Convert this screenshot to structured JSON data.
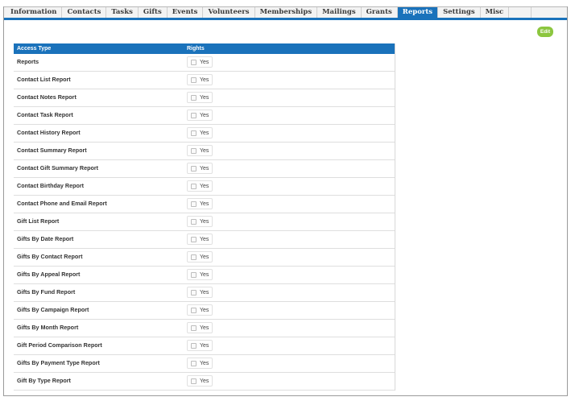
{
  "tabs": [
    {
      "label": "Information",
      "active": false
    },
    {
      "label": "Contacts",
      "active": false
    },
    {
      "label": "Tasks",
      "active": false
    },
    {
      "label": "Gifts",
      "active": false
    },
    {
      "label": "Events",
      "active": false
    },
    {
      "label": "Volunteers",
      "active": false
    },
    {
      "label": "Memberships",
      "active": false
    },
    {
      "label": "Mailings",
      "active": false
    },
    {
      "label": "Grants",
      "active": false
    },
    {
      "label": "Reports",
      "active": true
    },
    {
      "label": "Settings",
      "active": false
    },
    {
      "label": "Misc",
      "active": false
    }
  ],
  "edit_label": "Edit",
  "table": {
    "headers": {
      "access_type": "Access Type",
      "rights": "Rights"
    },
    "rows": [
      {
        "label": "Reports",
        "checkbox_label": "Yes",
        "checked": false
      },
      {
        "label": "Contact List Report",
        "checkbox_label": "Yes",
        "checked": false
      },
      {
        "label": "Contact Notes Report",
        "checkbox_label": "Yes",
        "checked": false
      },
      {
        "label": "Contact Task Report",
        "checkbox_label": "Yes",
        "checked": false
      },
      {
        "label": "Contact History Report",
        "checkbox_label": "Yes",
        "checked": false
      },
      {
        "label": "Contact Summary Report",
        "checkbox_label": "Yes",
        "checked": false
      },
      {
        "label": "Contact Gift Summary Report",
        "checkbox_label": "Yes",
        "checked": false
      },
      {
        "label": "Contact Birthday Report",
        "checkbox_label": "Yes",
        "checked": false
      },
      {
        "label": "Contact Phone and Email Report",
        "checkbox_label": "Yes",
        "checked": false
      },
      {
        "label": "Gift List Report",
        "checkbox_label": "Yes",
        "checked": false
      },
      {
        "label": "Gifts By Date Report",
        "checkbox_label": "Yes",
        "checked": false
      },
      {
        "label": "Gifts By Contact Report",
        "checkbox_label": "Yes",
        "checked": false
      },
      {
        "label": "Gifts By Appeal Report",
        "checkbox_label": "Yes",
        "checked": false
      },
      {
        "label": "Gifts By Fund Report",
        "checkbox_label": "Yes",
        "checked": false
      },
      {
        "label": "Gifts By Campaign Report",
        "checkbox_label": "Yes",
        "checked": false
      },
      {
        "label": "Gifts By Month Report",
        "checkbox_label": "Yes",
        "checked": false
      },
      {
        "label": "Gift Period Comparison Report",
        "checkbox_label": "Yes",
        "checked": false
      },
      {
        "label": "Gifts By Payment Type Report",
        "checkbox_label": "Yes",
        "checked": false
      },
      {
        "label": "Gift By Type Report",
        "checkbox_label": "Yes",
        "checked": false
      }
    ]
  }
}
